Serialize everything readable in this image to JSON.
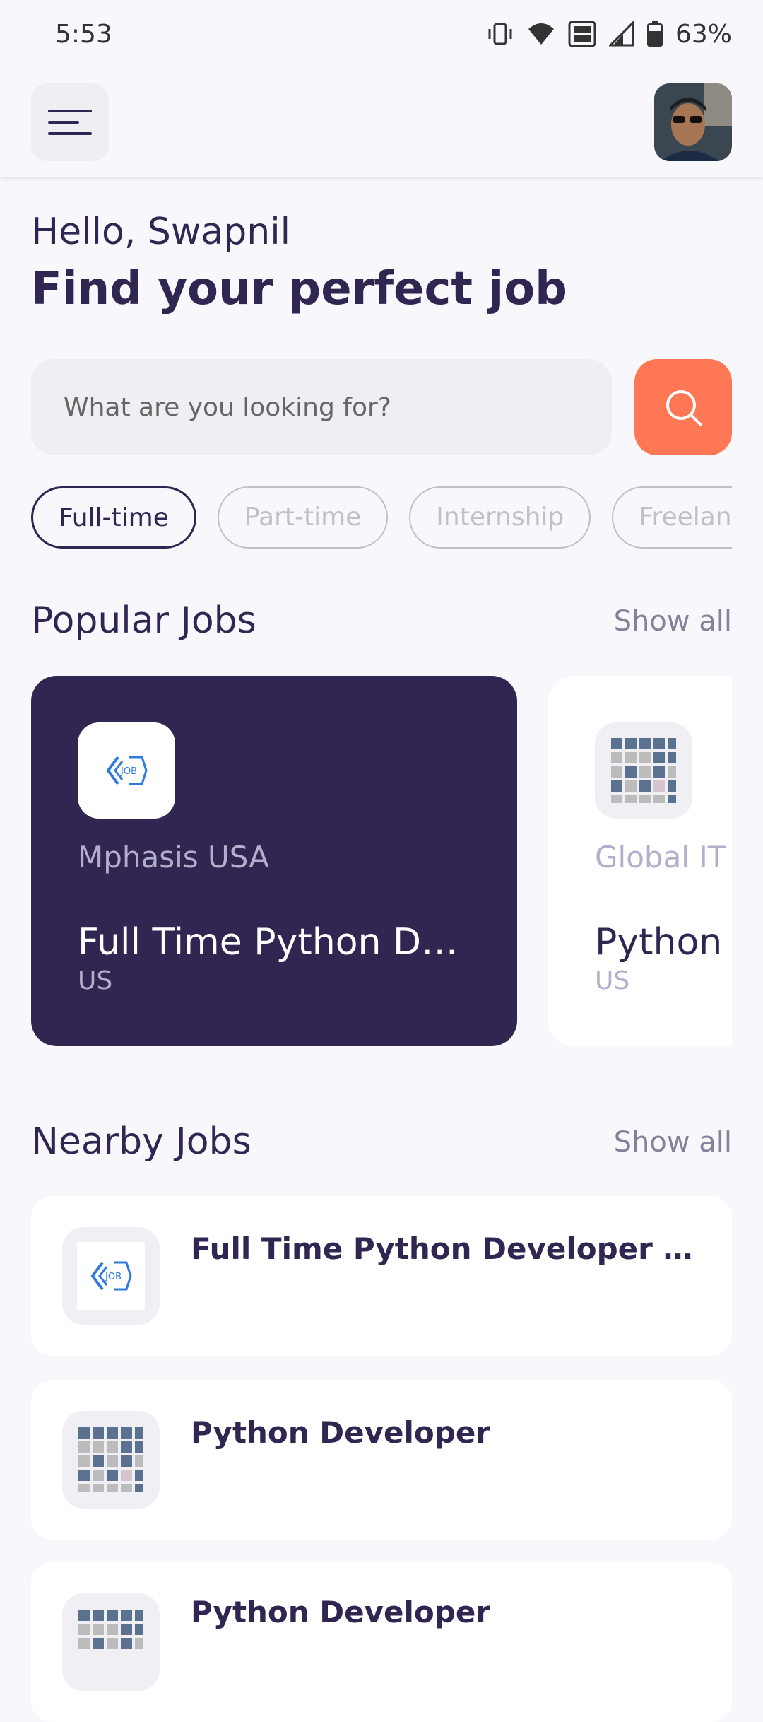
{
  "status_bar": {
    "time": "5:53",
    "battery": "63%",
    "icons": [
      "vibrate-icon",
      "wifi-icon",
      "volte-icon",
      "signal-icon",
      "battery-icon"
    ]
  },
  "header": {
    "menu_icon": "menu-icon",
    "avatar": "profile-avatar"
  },
  "greeting": "Hello, Swapnil",
  "headline": "Find your perfect job",
  "search": {
    "placeholder": "What are you looking for?",
    "button_icon": "search-icon"
  },
  "job_types": [
    {
      "label": "Full-time",
      "active": true
    },
    {
      "label": "Part-time",
      "active": false
    },
    {
      "label": "Internship",
      "active": false
    },
    {
      "label": "Freelance",
      "active": false
    }
  ],
  "popular": {
    "title": "Popular Jobs",
    "show_all": "Show all",
    "jobs": [
      {
        "company": "Mphasis USA",
        "title": "Full Time Python Developer Position",
        "country": "US",
        "logo": "job-logo"
      },
      {
        "company": "Global IT Con",
        "title": "Python Developer",
        "country": "US",
        "logo": "grid-logo"
      }
    ]
  },
  "nearby": {
    "title": "Nearby Jobs",
    "show_all": "Show all",
    "jobs": [
      {
        "title": "Full Time Python Developer Position",
        "logo": "job-logo"
      },
      {
        "title": "Python Developer",
        "logo": "grid-logo"
      },
      {
        "title": "Python Developer",
        "logo": "grid-logo"
      }
    ]
  },
  "colors": {
    "primary": "#312651",
    "accent": "#FF7754",
    "background": "#F8F8FC",
    "muted": "#83829A",
    "chip_border": "#C1C0C8"
  }
}
